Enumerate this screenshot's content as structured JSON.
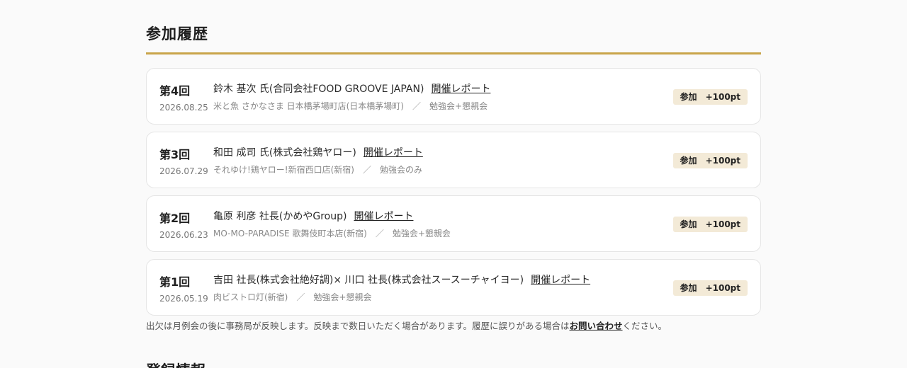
{
  "section": {
    "title": "参加履歴"
  },
  "history": [
    {
      "round": "第4回",
      "date": "2026.08.25",
      "speaker": "鈴木 基次 氏(合同会社FOOD GROOVE JAPAN)",
      "report_link": "開催レポート",
      "venue": "米と魚 さかなさま 日本橋茅場町店(日本橋茅場町)",
      "separator": "／",
      "format": "勉強会+懇親会",
      "status": "参加",
      "points": "+100pt"
    },
    {
      "round": "第3回",
      "date": "2026.07.29",
      "speaker": "和田 成司 氏(株式会社鶏ヤロー)",
      "report_link": "開催レポート",
      "venue": "それゆけ!鶏ヤロー!新宿西口店(新宿)",
      "separator": "／",
      "format": "勉強会のみ",
      "status": "参加",
      "points": "+100pt"
    },
    {
      "round": "第2回",
      "date": "2026.06.23",
      "speaker": "亀原 利彦 社長(かめやGroup)",
      "report_link": "開催レポート",
      "venue": "MO-MO-PARADISE 歌舞伎町本店(新宿)",
      "separator": "／",
      "format": "勉強会+懇親会",
      "status": "参加",
      "points": "+100pt"
    },
    {
      "round": "第1回",
      "date": "2026.05.19",
      "speaker": "吉田 社長(株式会社絶好調)× 川口 社長(株式会社スースーチャイヨー)",
      "report_link": "開催レポート",
      "venue": "肉ビストロ灯(新宿)",
      "separator": "／",
      "format": "勉強会+懇親会",
      "status": "参加",
      "points": "+100pt"
    }
  ],
  "note": {
    "before_link": "出欠は月例会の後に事務局が反映します。反映まで数日いただく場合があります。履歴に誤りがある場合は",
    "link": "お問い合わせ",
    "after_link": "ください。"
  },
  "next_section": {
    "title": "登録情報"
  },
  "colors": {
    "accent_rule": "#c9a44a",
    "badge_background": "#f3ead7",
    "page_background": "#fafafa",
    "card_background": "#ffffff"
  }
}
